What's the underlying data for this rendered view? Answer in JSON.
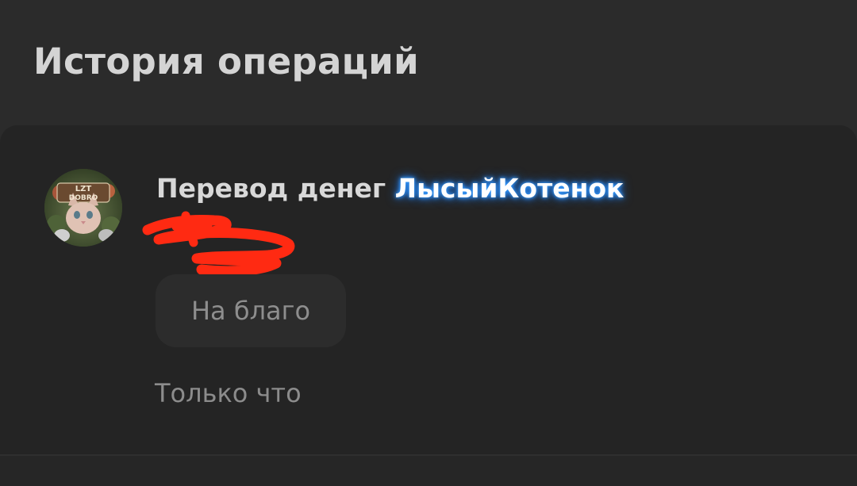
{
  "header": {
    "title": "История операций"
  },
  "transaction": {
    "avatar_icon": "user-avatar-icon",
    "title_prefix": "Перевод денег",
    "username": "ЛысыйКотенок",
    "username_glow_color": "#2b8cff",
    "comment": "На благо",
    "time": "Только что",
    "redaction_color": "#ff2a12"
  }
}
